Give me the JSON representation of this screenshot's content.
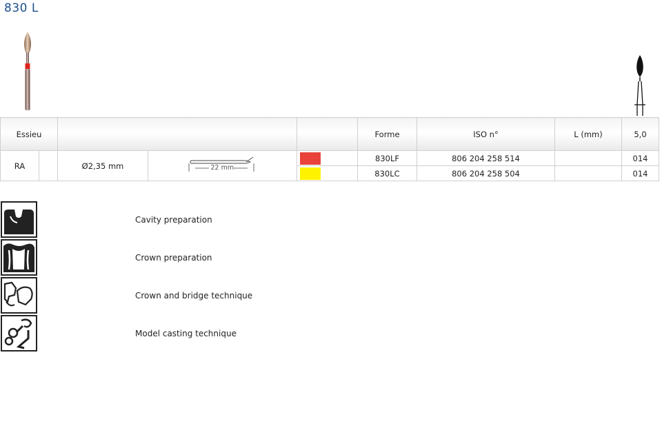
{
  "product": {
    "title": "830 L"
  },
  "table": {
    "headers": {
      "essieu": "Essieu",
      "forme": "Forme",
      "iso": "ISO n°",
      "length": "L (mm)",
      "size": "5,0"
    },
    "shank": {
      "type": "RA",
      "diameter": "Ø2,35 mm",
      "length_label": "22 mm"
    },
    "rows": [
      {
        "color": "#e8423a",
        "forme": "830LF",
        "iso": "806 204 258 514",
        "l_mm": "",
        "size": "014"
      },
      {
        "color": "#fff200",
        "forme": "830LC",
        "iso": "806 204 258 504",
        "l_mm": "",
        "size": "014"
      }
    ]
  },
  "applications": [
    {
      "icon": "cavity-preparation-icon",
      "label": "Cavity preparation"
    },
    {
      "icon": "crown-preparation-icon",
      "label": "Crown preparation"
    },
    {
      "icon": "crown-bridge-icon",
      "label": "Crown and bridge technique"
    },
    {
      "icon": "model-casting-icon",
      "label": "Model casting technique"
    }
  ]
}
